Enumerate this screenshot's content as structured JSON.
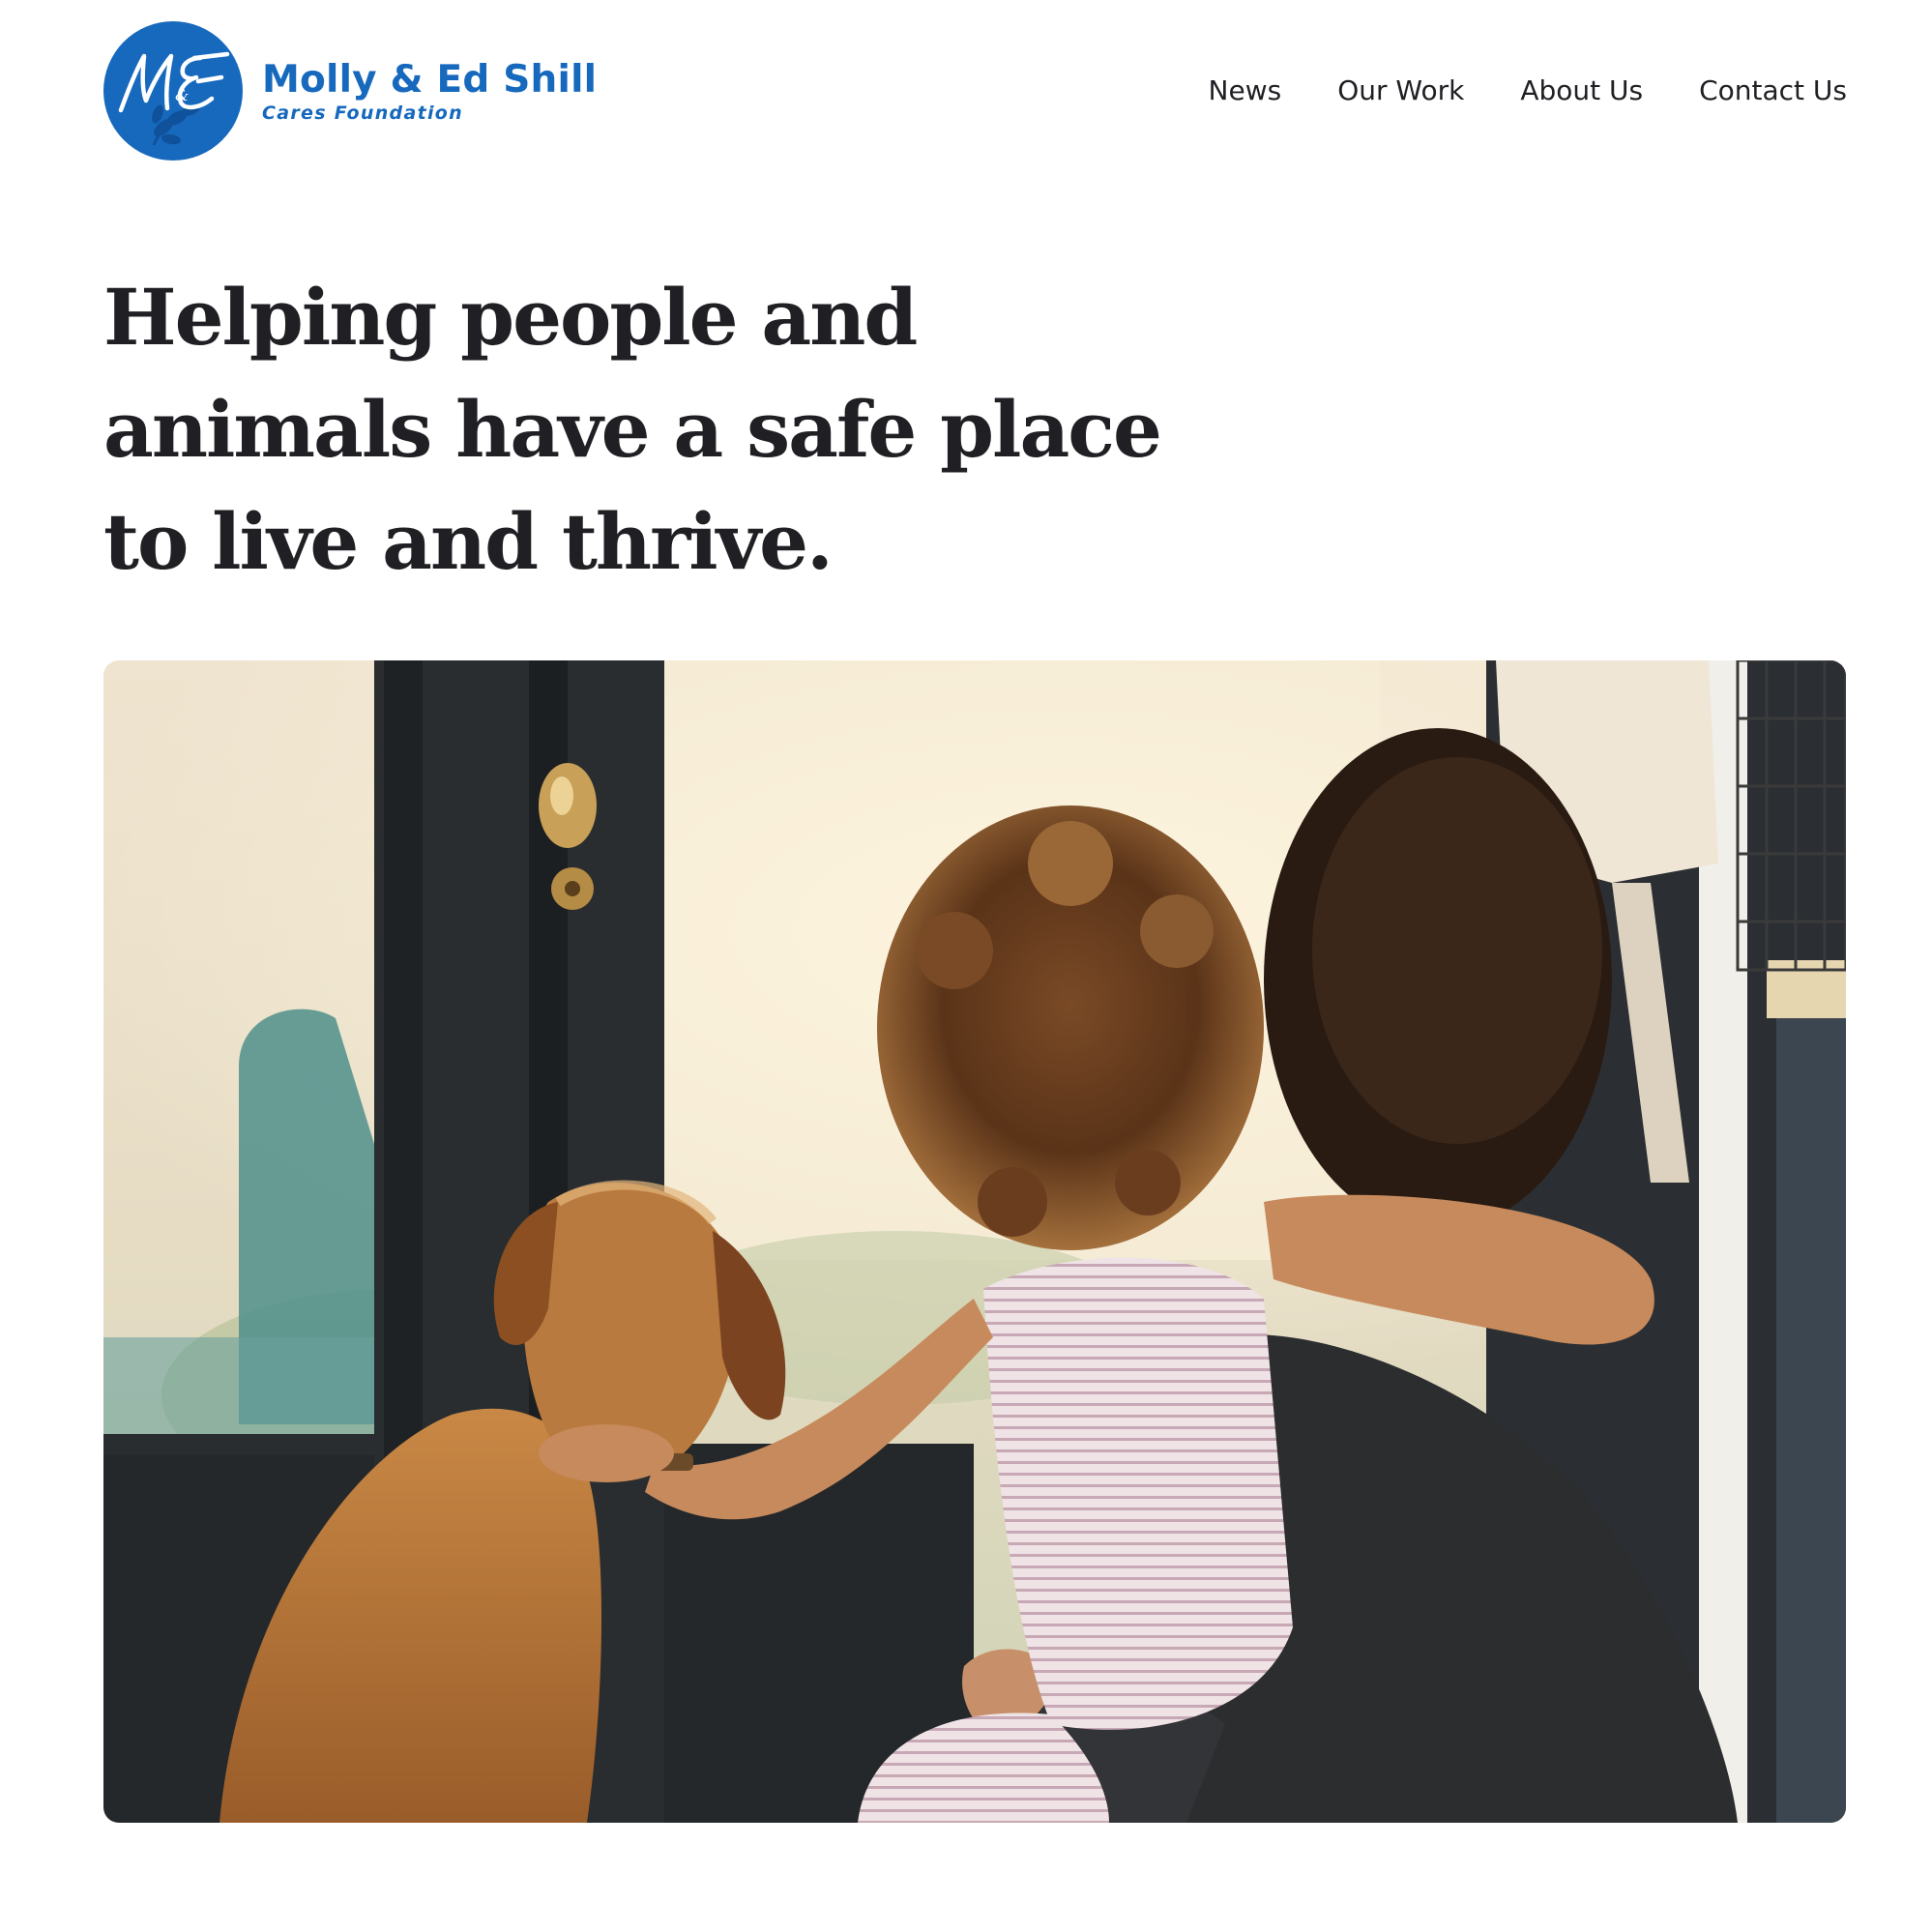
{
  "brand": {
    "monogram": "M&E",
    "name": "Molly & Ed Shill",
    "subtitle": "Cares Foundation",
    "color": "#1769bd"
  },
  "nav": {
    "items": [
      {
        "label": "News"
      },
      {
        "label": "Our Work"
      },
      {
        "label": "About Us"
      },
      {
        "label": "Contact Us"
      }
    ]
  },
  "hero": {
    "title": "Helping people and animals have a safe place to live and thrive."
  }
}
